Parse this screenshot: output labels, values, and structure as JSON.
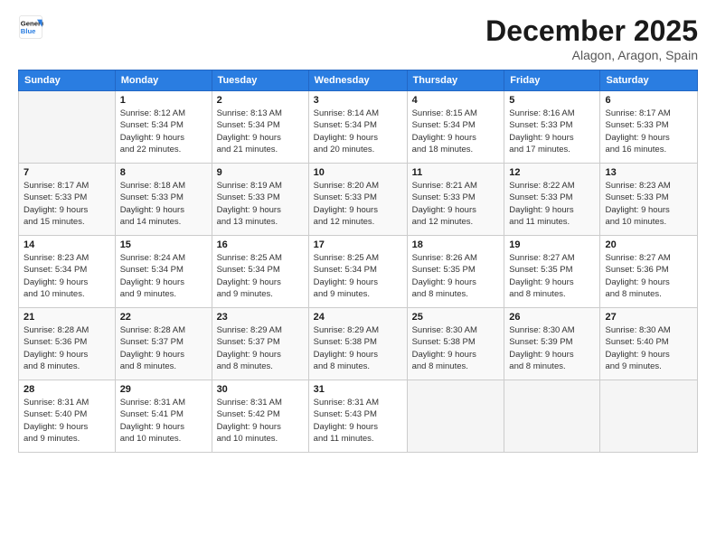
{
  "logo": {
    "line1": "General",
    "line2": "Blue"
  },
  "title": "December 2025",
  "subtitle": "Alagon, Aragon, Spain",
  "days_header": [
    "Sunday",
    "Monday",
    "Tuesday",
    "Wednesday",
    "Thursday",
    "Friday",
    "Saturday"
  ],
  "weeks": [
    [
      {
        "num": "",
        "info": ""
      },
      {
        "num": "1",
        "info": "Sunrise: 8:12 AM\nSunset: 5:34 PM\nDaylight: 9 hours\nand 22 minutes."
      },
      {
        "num": "2",
        "info": "Sunrise: 8:13 AM\nSunset: 5:34 PM\nDaylight: 9 hours\nand 21 minutes."
      },
      {
        "num": "3",
        "info": "Sunrise: 8:14 AM\nSunset: 5:34 PM\nDaylight: 9 hours\nand 20 minutes."
      },
      {
        "num": "4",
        "info": "Sunrise: 8:15 AM\nSunset: 5:34 PM\nDaylight: 9 hours\nand 18 minutes."
      },
      {
        "num": "5",
        "info": "Sunrise: 8:16 AM\nSunset: 5:33 PM\nDaylight: 9 hours\nand 17 minutes."
      },
      {
        "num": "6",
        "info": "Sunrise: 8:17 AM\nSunset: 5:33 PM\nDaylight: 9 hours\nand 16 minutes."
      }
    ],
    [
      {
        "num": "7",
        "info": "Sunrise: 8:17 AM\nSunset: 5:33 PM\nDaylight: 9 hours\nand 15 minutes."
      },
      {
        "num": "8",
        "info": "Sunrise: 8:18 AM\nSunset: 5:33 PM\nDaylight: 9 hours\nand 14 minutes."
      },
      {
        "num": "9",
        "info": "Sunrise: 8:19 AM\nSunset: 5:33 PM\nDaylight: 9 hours\nand 13 minutes."
      },
      {
        "num": "10",
        "info": "Sunrise: 8:20 AM\nSunset: 5:33 PM\nDaylight: 9 hours\nand 12 minutes."
      },
      {
        "num": "11",
        "info": "Sunrise: 8:21 AM\nSunset: 5:33 PM\nDaylight: 9 hours\nand 12 minutes."
      },
      {
        "num": "12",
        "info": "Sunrise: 8:22 AM\nSunset: 5:33 PM\nDaylight: 9 hours\nand 11 minutes."
      },
      {
        "num": "13",
        "info": "Sunrise: 8:23 AM\nSunset: 5:33 PM\nDaylight: 9 hours\nand 10 minutes."
      }
    ],
    [
      {
        "num": "14",
        "info": "Sunrise: 8:23 AM\nSunset: 5:34 PM\nDaylight: 9 hours\nand 10 minutes."
      },
      {
        "num": "15",
        "info": "Sunrise: 8:24 AM\nSunset: 5:34 PM\nDaylight: 9 hours\nand 9 minutes."
      },
      {
        "num": "16",
        "info": "Sunrise: 8:25 AM\nSunset: 5:34 PM\nDaylight: 9 hours\nand 9 minutes."
      },
      {
        "num": "17",
        "info": "Sunrise: 8:25 AM\nSunset: 5:34 PM\nDaylight: 9 hours\nand 9 minutes."
      },
      {
        "num": "18",
        "info": "Sunrise: 8:26 AM\nSunset: 5:35 PM\nDaylight: 9 hours\nand 8 minutes."
      },
      {
        "num": "19",
        "info": "Sunrise: 8:27 AM\nSunset: 5:35 PM\nDaylight: 9 hours\nand 8 minutes."
      },
      {
        "num": "20",
        "info": "Sunrise: 8:27 AM\nSunset: 5:36 PM\nDaylight: 9 hours\nand 8 minutes."
      }
    ],
    [
      {
        "num": "21",
        "info": "Sunrise: 8:28 AM\nSunset: 5:36 PM\nDaylight: 9 hours\nand 8 minutes."
      },
      {
        "num": "22",
        "info": "Sunrise: 8:28 AM\nSunset: 5:37 PM\nDaylight: 9 hours\nand 8 minutes."
      },
      {
        "num": "23",
        "info": "Sunrise: 8:29 AM\nSunset: 5:37 PM\nDaylight: 9 hours\nand 8 minutes."
      },
      {
        "num": "24",
        "info": "Sunrise: 8:29 AM\nSunset: 5:38 PM\nDaylight: 9 hours\nand 8 minutes."
      },
      {
        "num": "25",
        "info": "Sunrise: 8:30 AM\nSunset: 5:38 PM\nDaylight: 9 hours\nand 8 minutes."
      },
      {
        "num": "26",
        "info": "Sunrise: 8:30 AM\nSunset: 5:39 PM\nDaylight: 9 hours\nand 8 minutes."
      },
      {
        "num": "27",
        "info": "Sunrise: 8:30 AM\nSunset: 5:40 PM\nDaylight: 9 hours\nand 9 minutes."
      }
    ],
    [
      {
        "num": "28",
        "info": "Sunrise: 8:31 AM\nSunset: 5:40 PM\nDaylight: 9 hours\nand 9 minutes."
      },
      {
        "num": "29",
        "info": "Sunrise: 8:31 AM\nSunset: 5:41 PM\nDaylight: 9 hours\nand 10 minutes."
      },
      {
        "num": "30",
        "info": "Sunrise: 8:31 AM\nSunset: 5:42 PM\nDaylight: 9 hours\nand 10 minutes."
      },
      {
        "num": "31",
        "info": "Sunrise: 8:31 AM\nSunset: 5:43 PM\nDaylight: 9 hours\nand 11 minutes."
      },
      {
        "num": "",
        "info": ""
      },
      {
        "num": "",
        "info": ""
      },
      {
        "num": "",
        "info": ""
      }
    ]
  ]
}
